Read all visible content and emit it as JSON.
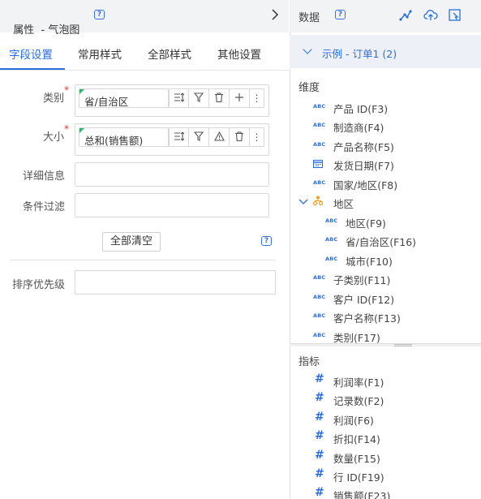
{
  "properties": {
    "title": "属性  - 气泡图",
    "tabs": [
      "字段设置",
      "常用样式",
      "全部样式",
      "其他设置"
    ],
    "active_tab": "字段设置",
    "fields": {
      "category_label": "类别",
      "category_value": "省/自治区",
      "size_label": "大小",
      "size_value": "总和(销售额)",
      "detail_label": "详细信息",
      "filter_label": "条件过滤",
      "clear_all": "全部清空",
      "sort_label": "排序优先级"
    }
  },
  "data_panel": {
    "title": "数据",
    "dataset": "示例 - 订单1 (2)",
    "dimensions_title": "维度",
    "dimensions": [
      {
        "label": "产品 ID(F3)",
        "icon": "abc-icon"
      },
      {
        "label": "制造商(F4)",
        "icon": "abc-icon"
      },
      {
        "label": "产品名称(F5)",
        "icon": "abc-icon"
      },
      {
        "label": "发货日期(F7)",
        "icon": "calendar-icon"
      },
      {
        "label": "国家/地区(F8)",
        "icon": "abc-icon"
      },
      {
        "label": "地区",
        "icon": "hierarchy-icon"
      },
      {
        "label": "地区(F9)",
        "icon": "abc-icon"
      },
      {
        "label": "省/自治区(F16)",
        "icon": "abc-icon"
      },
      {
        "label": "城市(F10)",
        "icon": "abc-icon"
      },
      {
        "label": "子类别(F11)",
        "icon": "abc-icon"
      },
      {
        "label": "客户 ID(F12)",
        "icon": "abc-icon"
      },
      {
        "label": "客户名称(F13)",
        "icon": "abc-icon"
      },
      {
        "label": "类别(F17)",
        "icon": "abc-icon"
      }
    ],
    "measures_title": "指标",
    "measures": [
      {
        "label": "利润率(F1)"
      },
      {
        "label": "记录数(F2)"
      },
      {
        "label": "利润(F6)"
      },
      {
        "label": "折扣(F14)"
      },
      {
        "label": "数量(F15)"
      },
      {
        "label": "行 ID(F19)"
      },
      {
        "label": "销售额(F23)"
      }
    ],
    "abc_glyph": "ABC",
    "measure_glyph": "#"
  },
  "colors": {
    "accent": "#2a6ee0",
    "required": "#e33333",
    "field_marker": "#2db36b"
  }
}
